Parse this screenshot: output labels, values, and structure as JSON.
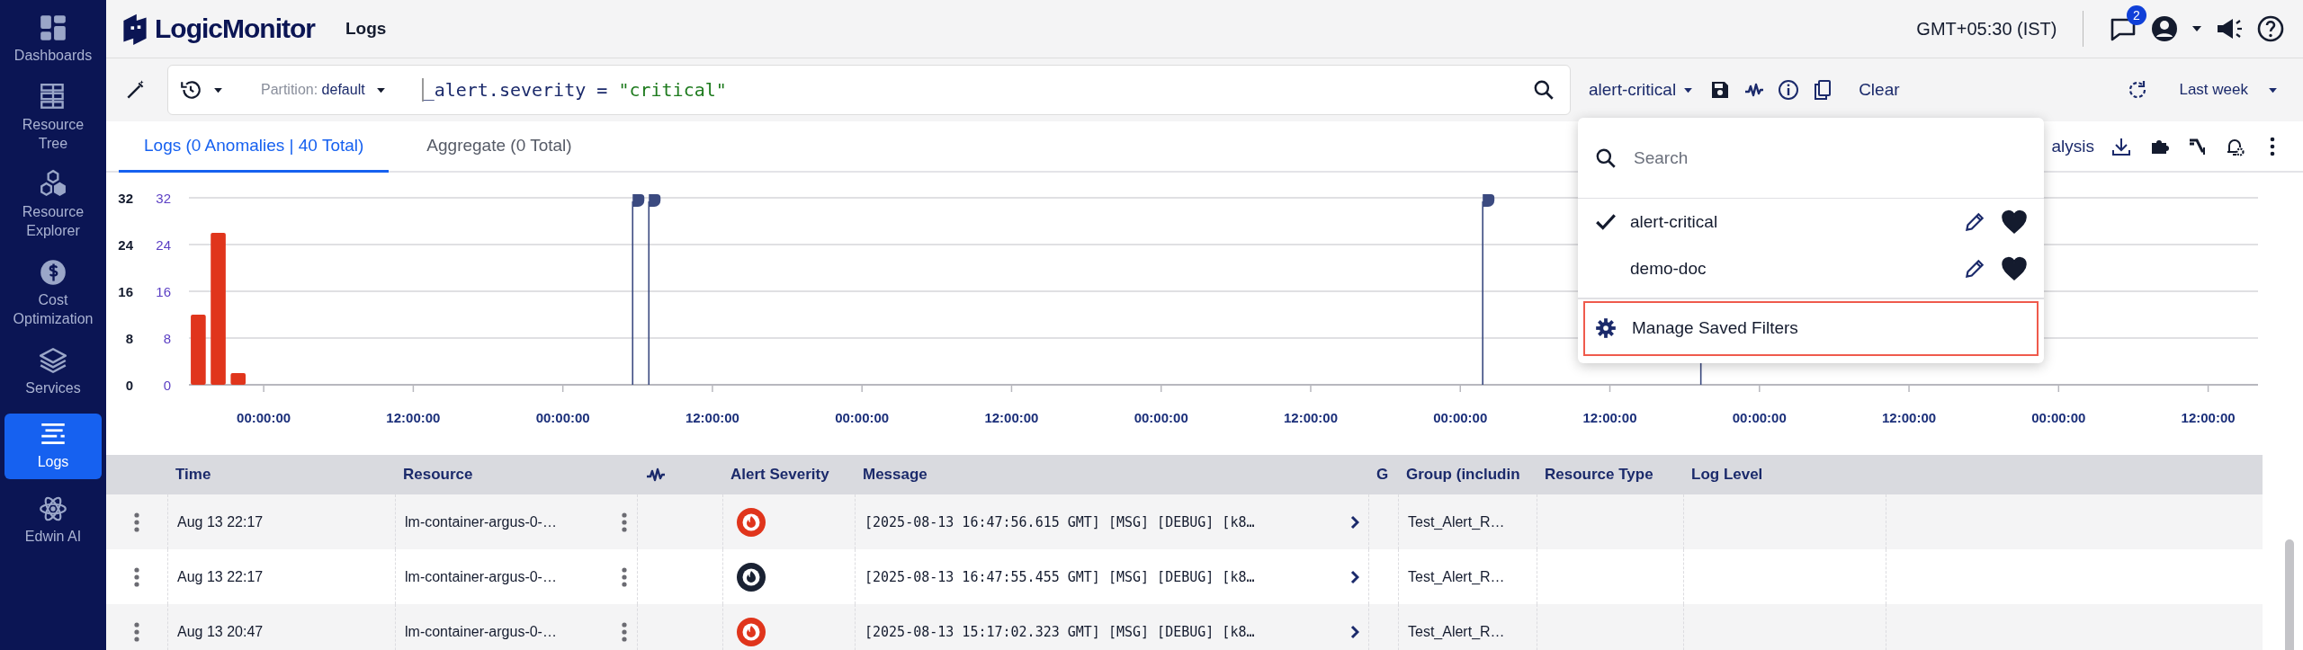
{
  "sidebar": {
    "items": [
      {
        "label": "Dashboards",
        "selected": false
      },
      {
        "label": "Resource Tree",
        "selected": false
      },
      {
        "label": "Resource Explorer",
        "selected": false
      },
      {
        "label": "Cost Optimization",
        "selected": false
      },
      {
        "label": "Services",
        "selected": false
      },
      {
        "label": "Logs",
        "selected": true
      },
      {
        "label": "Edwin AI",
        "selected": false
      }
    ]
  },
  "header": {
    "logo_text": "LogicMonitor",
    "page_title": "Logs",
    "timezone": "GMT+05:30 (IST)",
    "notification_count": "2"
  },
  "toolbar": {
    "partition_label": "Partition:",
    "partition_value": "default",
    "query": [
      {
        "kind": "field",
        "text": "_alert.severity"
      },
      {
        "kind": "operator",
        "text": "="
      },
      {
        "kind": "string",
        "text": "\"critical\""
      }
    ],
    "saved_filter": "alert-critical",
    "clear": "Clear",
    "time_range": "Last week"
  },
  "tabs": [
    {
      "label": "Logs (0 Anomalies | 40 Total)",
      "selected": true
    },
    {
      "label": "Aggregate (0 Total)",
      "selected": false
    }
  ],
  "tab_actions": {
    "partial_label": "alysis"
  },
  "chart": {
    "chart_data": {
      "type": "bar",
      "grid": true,
      "categories": [
        null,
        null,
        null
      ],
      "series": [
        {
          "color": "#e0351c",
          "values": [
            12,
            26,
            2
          ]
        }
      ],
      "ylim": [
        0,
        32
      ],
      "yticks": [
        0,
        8,
        16,
        24,
        32
      ]
    },
    "secondary_axis_labels": [
      "32",
      "24",
      "16",
      "8",
      "0"
    ],
    "time_labels": [
      "00:00:00",
      "12:00:00",
      "00:00:00",
      "12:00:00",
      "00:00:00",
      "12:00:00",
      "00:00:00",
      "12:00:00",
      "00:00:00",
      "12:00:00",
      "00:00:00",
      "12:00:00",
      "00:00:00",
      "12:00:00"
    ]
  },
  "table": {
    "columns": [
      {
        "kind": "menu"
      },
      {
        "kind": "text",
        "label": "Time"
      },
      {
        "kind": "text",
        "label": "Resource"
      },
      {
        "kind": "pulse"
      },
      {
        "kind": "text",
        "label": "Alert Severity"
      },
      {
        "kind": "text",
        "label": "Message"
      },
      {
        "kind": "text",
        "label": "G"
      },
      {
        "kind": "text",
        "label": "Group (includin"
      },
      {
        "kind": "text",
        "label": "Resource Type"
      },
      {
        "kind": "text",
        "label": "Log Level"
      }
    ],
    "rows": [
      {
        "time": "Aug 13 22:17",
        "resource": "lm-container-argus-0-…",
        "color": "#e0351c",
        "message": "[2025-08-13 16:47:56.615 GMT] [MSG] [DEBUG] [k8…",
        "group": "Test_Alert_R…"
      },
      {
        "time": "Aug 13 22:17",
        "resource": "lm-container-argus-0-…",
        "color": "#1a2233",
        "message": "[2025-08-13 16:47:55.455 GMT] [MSG] [DEBUG] [k8…",
        "group": "Test_Alert_R…"
      },
      {
        "time": "Aug 13 20:47",
        "resource": "lm-container-argus-0-…",
        "color": "#e0351c",
        "message": "[2025-08-13 15:17:02.323 GMT] [MSG] [DEBUG] [k8…",
        "group": "Test_Alert_R…"
      }
    ]
  },
  "filter_menu": {
    "search_placeholder": "Search",
    "items": [
      {
        "label": "alert-critical",
        "selected": true,
        "favorite": true
      },
      {
        "label": "demo-doc",
        "selected": false,
        "favorite": true
      }
    ],
    "manage_label": "Manage Saved Filters",
    "manage_highlighted": true
  }
}
